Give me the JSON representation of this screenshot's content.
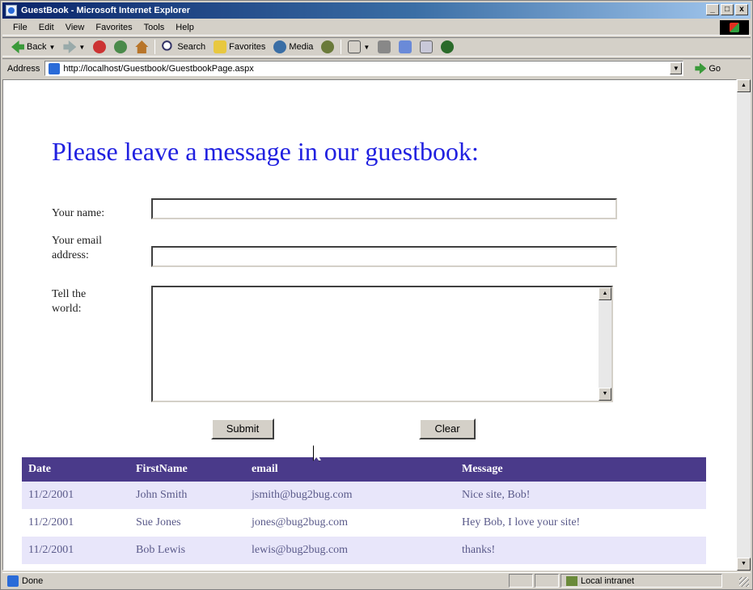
{
  "window": {
    "title": "GuestBook - Microsoft Internet Explorer",
    "minimize": "_",
    "maximize": "□",
    "close": "x"
  },
  "menu": [
    "File",
    "Edit",
    "View",
    "Favorites",
    "Tools",
    "Help"
  ],
  "toolbar": {
    "back_label": "Back",
    "search_label": "Search",
    "favorites_label": "Favorites",
    "media_label": "Media"
  },
  "address": {
    "label": "Address",
    "url": "http://localhost/Guestbook/GuestbookPage.aspx",
    "go_label": "Go"
  },
  "page": {
    "title": "Please leave a message in our guestbook:",
    "name_label": "Your name:",
    "email_label_line1": "Your email",
    "email_label_line2": "address:",
    "message_label_line1": "Tell the",
    "message_label_line2": "world:",
    "name_value": "",
    "email_value": "",
    "message_value": "",
    "submit_label": "Submit",
    "clear_label": "Clear"
  },
  "grid": {
    "headers": [
      "Date",
      "FirstName",
      "email",
      "Message"
    ],
    "rows": [
      {
        "date": "11/2/2001",
        "name": "John Smith",
        "email": "jsmith@bug2bug.com",
        "message": "Nice site, Bob!"
      },
      {
        "date": "11/2/2001",
        "name": "Sue Jones",
        "email": "jones@bug2bug.com",
        "message": "Hey Bob, I love your site!"
      },
      {
        "date": "11/2/2001",
        "name": "Bob Lewis",
        "email": "lewis@bug2bug.com",
        "message": "thanks!"
      }
    ]
  },
  "status": {
    "text": "Done",
    "zone": "Local intranet"
  },
  "colors": {
    "title_text": "#2020e0",
    "grid_header": "#4a3a8a",
    "grid_row_alt": "#e8e6fa",
    "grid_text": "#5a5a8a"
  }
}
